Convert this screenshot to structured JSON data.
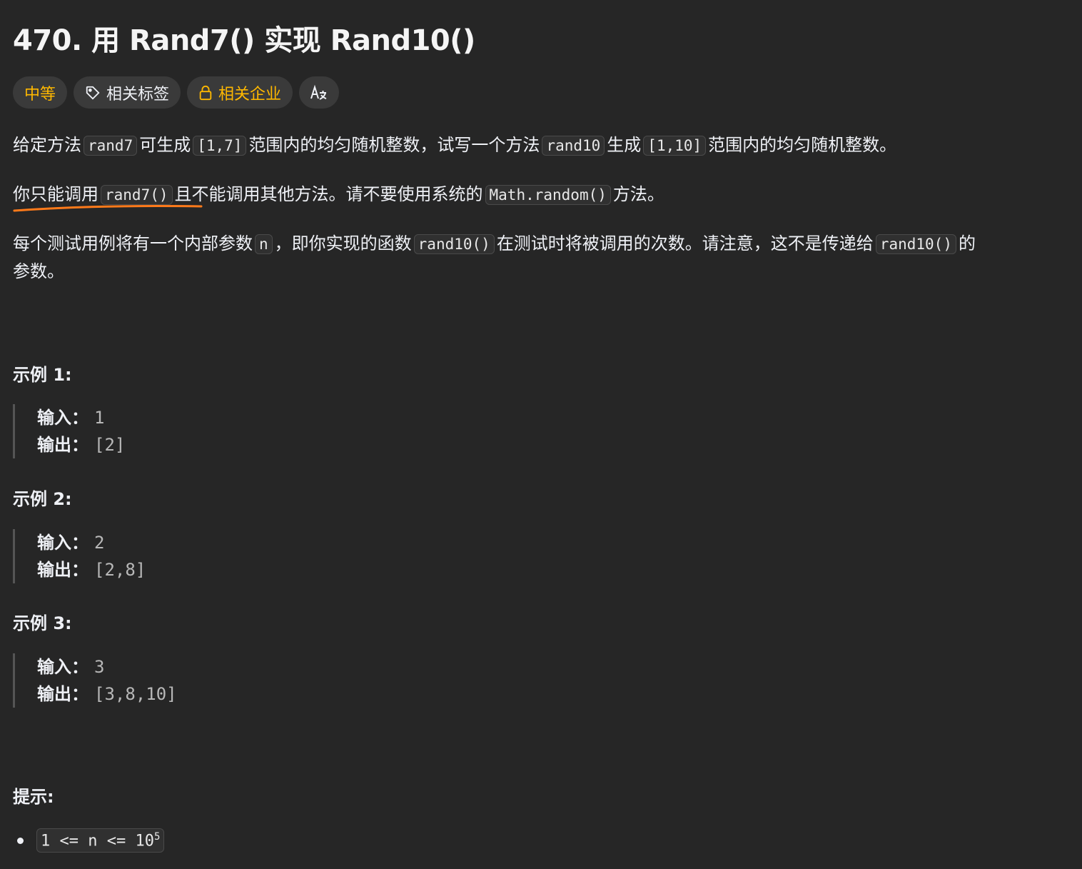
{
  "title": "470. 用 Rand7() 实现 Rand10()",
  "tags": {
    "difficulty": "中等",
    "topics": "相关标签",
    "companies": "相关企业",
    "translate_icon": "translate-icon"
  },
  "description": {
    "p1": {
      "t1": "给定方法",
      "c1": "rand7",
      "t2": "可生成",
      "c2": "[1,7]",
      "t3": "范围内的均匀随机整数，试写一个方法",
      "c3": "rand10",
      "t4": "生成",
      "c4": "[1,10]",
      "t5": "范围内的均匀随机整数。"
    },
    "p2": {
      "t1": "你只能调用",
      "c1": "rand7()",
      "t2": "且不能调用其他方法。请不要使用系统的",
      "c2": "Math.random()",
      "t3": "方法。"
    },
    "p3": {
      "t1": "每个测试用例将有一个内部参数",
      "c1": "n",
      "t2": "，即你实现的函数",
      "c2": "rand10()",
      "t3": "在测试时将被调用的次数。请注意，这不是传递给",
      "c3": "rand10()",
      "t4": "的",
      "t5": "参数。"
    }
  },
  "examples": [
    {
      "heading": "示例 1:",
      "input_label": "输入：",
      "input": "1",
      "output_label": "输出：",
      "output": "[2]"
    },
    {
      "heading": "示例 2:",
      "input_label": "输入：",
      "input": "2",
      "output_label": "输出：",
      "output": "[2,8]"
    },
    {
      "heading": "示例 3:",
      "input_label": "输入：",
      "input": "3",
      "output_label": "输出：",
      "output": "[3,8,10]"
    }
  ],
  "hints": {
    "heading": "提示:",
    "items": [
      {
        "text": "1 <= n <= 10",
        "sup": "5"
      }
    ]
  },
  "colors": {
    "background": "#262626",
    "difficulty_medium": "#ffb800",
    "annotation": "#ff7a1a"
  }
}
